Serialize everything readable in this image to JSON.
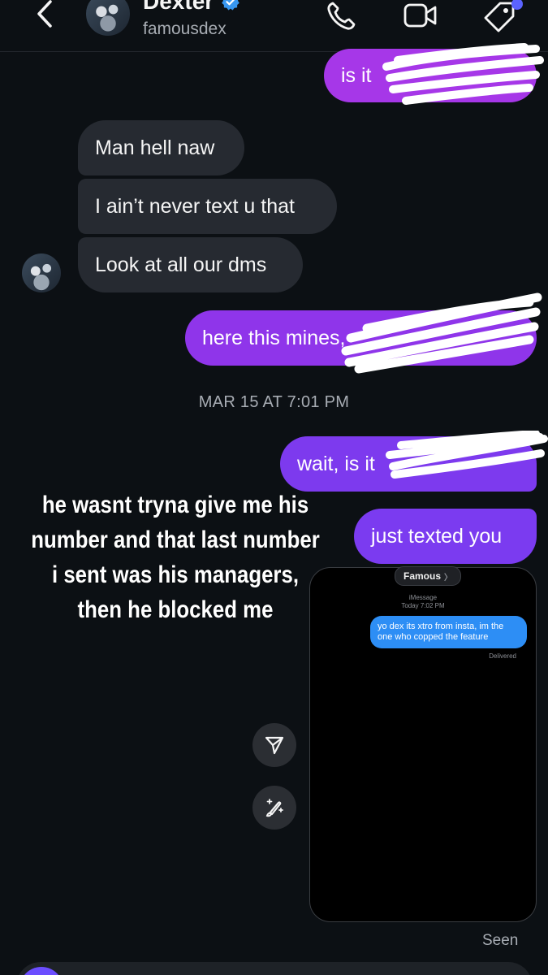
{
  "header": {
    "name": "Dexter",
    "username": "famousdex"
  },
  "messages": {
    "out_top": "is it",
    "in_1": "Man hell naw",
    "in_2": "I ain’t never text u that",
    "in_3": "Look at all our dms",
    "out_2": "here this mines,",
    "timestamp": "MAR 15 AT 7:01 PM",
    "out_3": "wait, is it",
    "out_4": "just texted you",
    "seen": "Seen"
  },
  "caption": "he wasnt tryna give me his number and that last number i sent was his managers, then he blocked me",
  "screenshot": {
    "contact": "Famous",
    "service": "iMessage",
    "time": "Today 7:02 PM",
    "message": "yo dex its xtro from insta, im the one who copped the feature",
    "status": "Delivered"
  },
  "colors": {
    "background": "#0c1014",
    "incoming_bubble": "#262a31",
    "outgoing_top": "#a637e8",
    "outgoing_bottom": "#7c3aed",
    "verified": "#3897f0",
    "imessage_blue": "#2d8ef5"
  },
  "icons": [
    "back-chevron-icon",
    "verified-badge-icon",
    "phone-icon",
    "video-icon",
    "tag-icon",
    "send-icon",
    "magic-brush-icon"
  ]
}
